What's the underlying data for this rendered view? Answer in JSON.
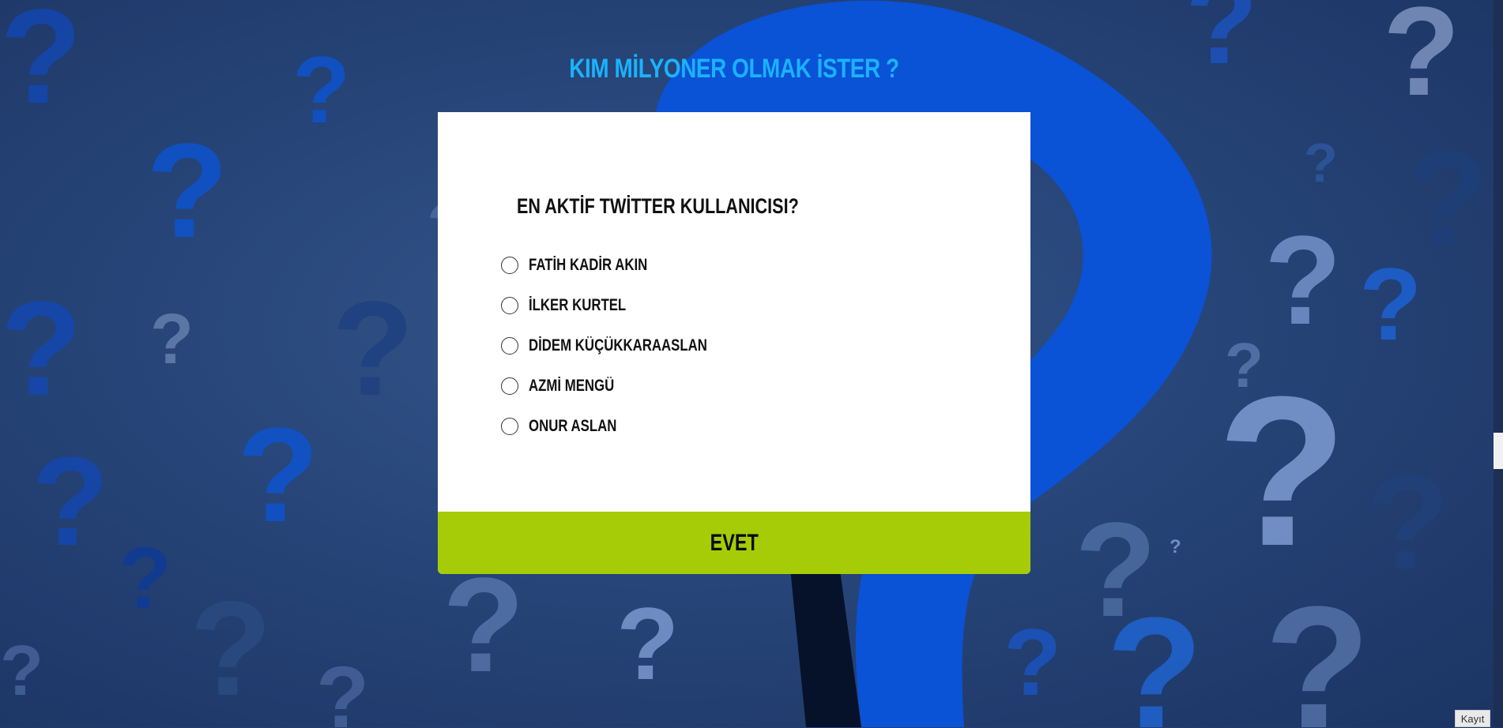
{
  "page": {
    "title": "KIM MİLYONER OLMAK İSTER ?"
  },
  "quiz": {
    "question": "EN AKTİF TWİTTER KULLANICISI?",
    "options": [
      {
        "label": "FATİH KADİR AKIN"
      },
      {
        "label": "İLKER KURTEL"
      },
      {
        "label": "DİDEM KÜÇÜKKARAASLAN"
      },
      {
        "label": "AZMİ MENGÜ"
      },
      {
        "label": "ONUR ASLAN"
      }
    ],
    "submit_label": "EVET"
  },
  "footer": {
    "record_label": "Kayıt"
  },
  "background": {
    "motif_icon": "question-mark-icon",
    "colors": {
      "base": "#274578",
      "accent": "#0a55d9",
      "title": "#1ab2ff",
      "button": "#a6cc07"
    }
  }
}
